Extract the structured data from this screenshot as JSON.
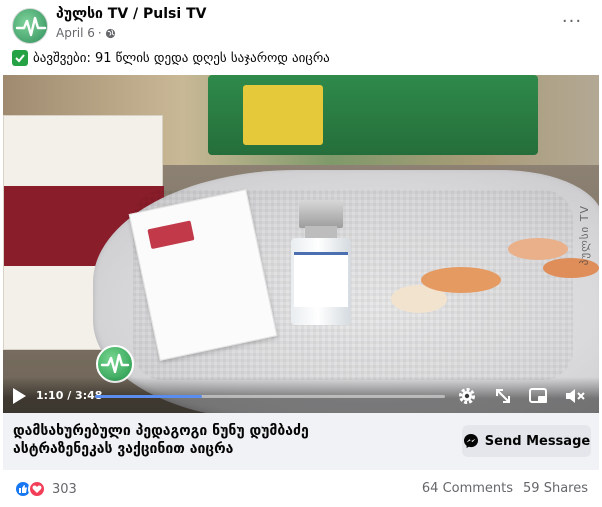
{
  "post": {
    "page_name": "პულსი TV / Pulsi TV",
    "date": "April 6",
    "date_separator": "·",
    "text": "ბავშვები: 91 წლის დედა დღეს საჯაროდ აიცრა",
    "more_label": "···"
  },
  "video": {
    "watermark": "პულსი TV",
    "elapsed": "1:10",
    "duration": "3:48",
    "time_display": "1:10 / 3:48",
    "progress": 0.307,
    "accent_color": "#5b8def"
  },
  "cta": {
    "title_line1": "დამსახურებული პედაგოგი ნუნუ დუმბაძე",
    "title_line2": "ასტრაზენეკას ვაქცინით აიცრა",
    "button_label": "Send Message"
  },
  "footer": {
    "reaction_count": "303",
    "comments": "64 Comments",
    "shares": "59 Shares"
  },
  "icons": {
    "privacy": "globe-icon",
    "more": "more-options-icon",
    "check": "check-icon",
    "play": "play-icon",
    "settings": "gear-icon",
    "fullscreen": "expand-icon",
    "pip": "picture-in-picture-icon",
    "volume": "muted-volume-icon",
    "messenger": "messenger-icon",
    "like": "like-icon",
    "love": "love-icon"
  },
  "colors": {
    "brand_blue": "#1877f2",
    "love_red": "#f33e58",
    "check_green": "#25a244"
  }
}
